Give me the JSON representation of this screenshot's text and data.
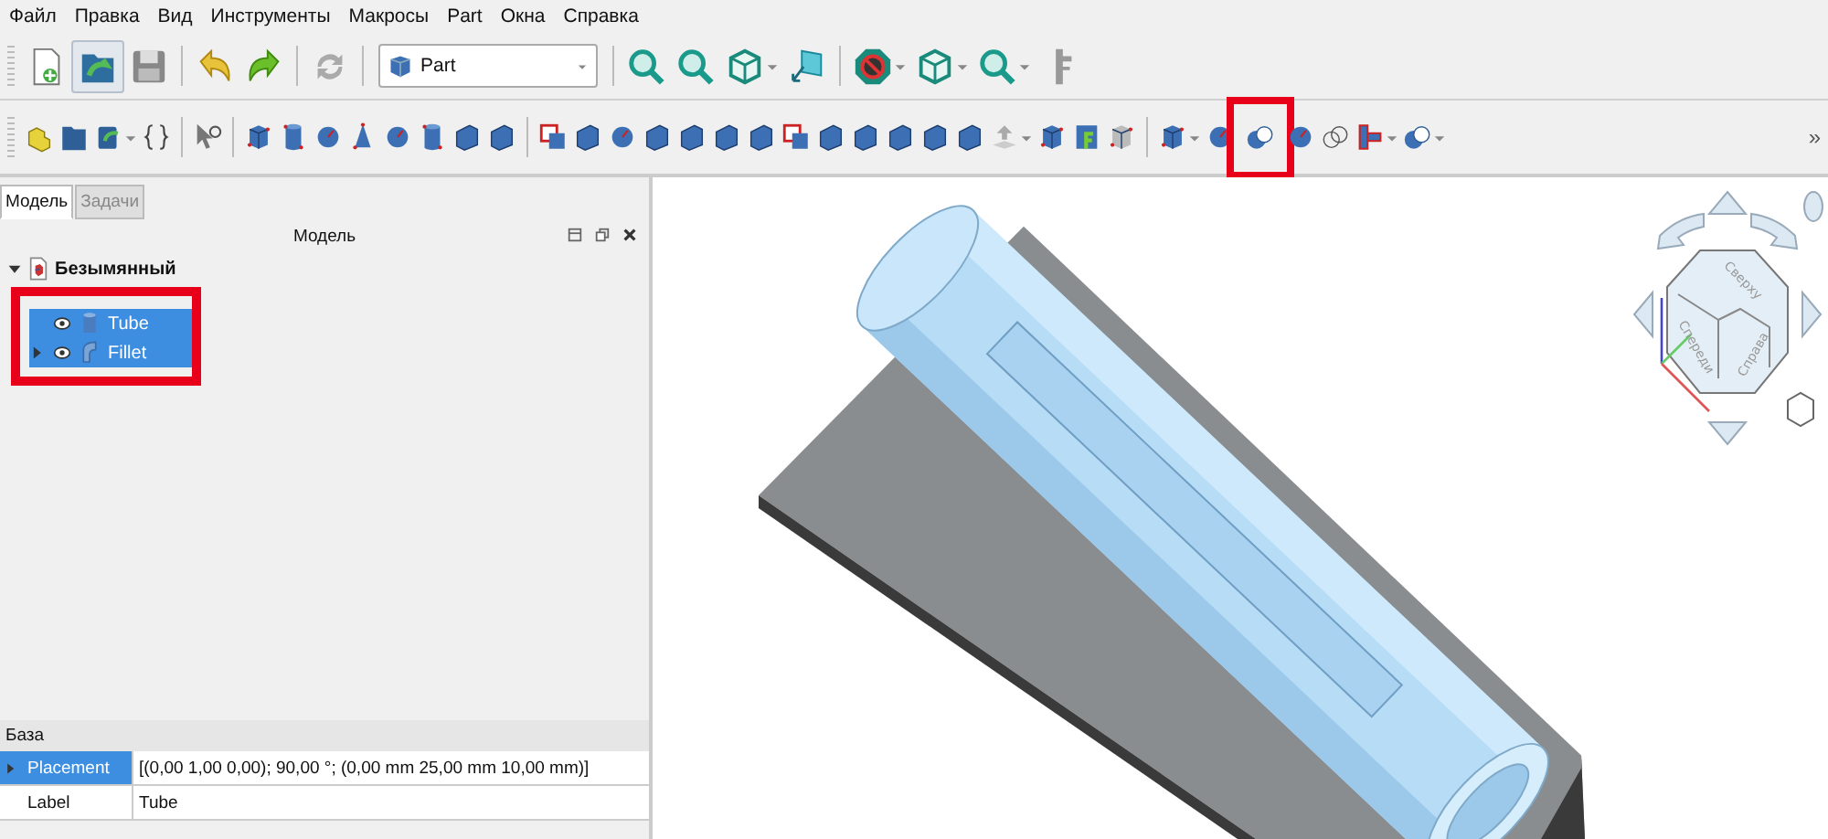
{
  "menu": [
    "Файл",
    "Правка",
    "Вид",
    "Инструменты",
    "Макросы",
    "Part",
    "Окна",
    "Справка"
  ],
  "workbench_selector": {
    "value": "Part"
  },
  "toolbar_overflow": "»",
  "panel": {
    "tabs": [
      {
        "label": "Модель",
        "selected": true
      },
      {
        "label": "Задачи",
        "selected": false
      }
    ],
    "title": "Модель",
    "tree": [
      {
        "label": "Безымянный",
        "expanded": true,
        "selected": false,
        "children": [
          {
            "label": "Tube",
            "selected": true
          },
          {
            "label": "Fillet",
            "selected": true,
            "expanded": false
          }
        ]
      }
    ]
  },
  "properties": {
    "group": "База",
    "rows": [
      {
        "name": "Placement",
        "value": "[(0,00 1,00 0,00); 90,00 °; (0,00 mm  25,00 mm  10,00 mm)]",
        "expanded": false,
        "selected": true
      },
      {
        "name": "Label",
        "value": "Tube",
        "selected": false
      }
    ]
  },
  "view": {
    "navigation_cube": {
      "faces": [
        "Сверху",
        "Спереди",
        "Справа"
      ]
    }
  }
}
